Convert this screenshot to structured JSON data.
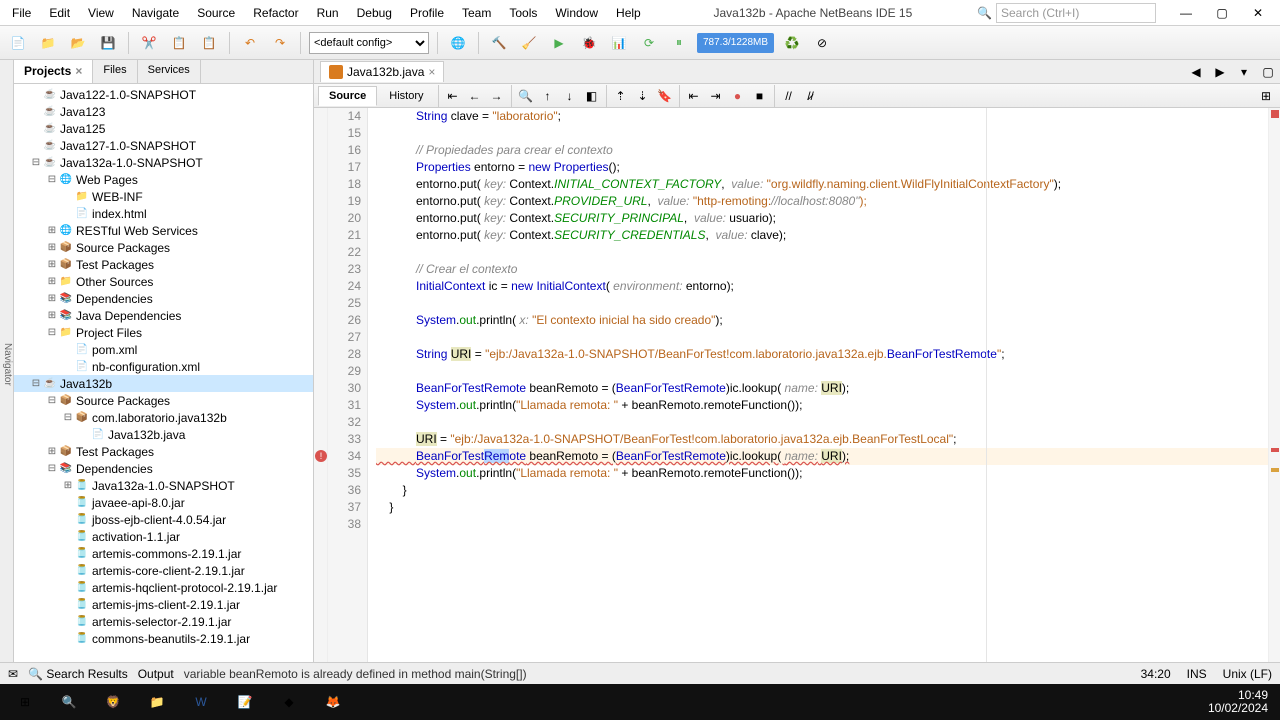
{
  "window": {
    "title": "Java132b - Apache NetBeans IDE 15",
    "search_placeholder": "Search (Ctrl+I)"
  },
  "menus": [
    "File",
    "Edit",
    "View",
    "Navigate",
    "Source",
    "Refactor",
    "Run",
    "Debug",
    "Profile",
    "Team",
    "Tools",
    "Window",
    "Help"
  ],
  "config_select": "<default config>",
  "memory": "787.3/1228MB",
  "left_tabs": {
    "projects": "Projects",
    "files": "Files",
    "services": "Services"
  },
  "tree": [
    {
      "d": 1,
      "exp": "",
      "icon": "☕",
      "label": "Java122-1.0-SNAPSHOT"
    },
    {
      "d": 1,
      "exp": "",
      "icon": "☕",
      "label": "Java123"
    },
    {
      "d": 1,
      "exp": "",
      "icon": "☕",
      "label": "Java125"
    },
    {
      "d": 1,
      "exp": "",
      "icon": "☕",
      "label": "Java127-1.0-SNAPSHOT"
    },
    {
      "d": 1,
      "exp": "−",
      "icon": "☕",
      "label": "Java132a-1.0-SNAPSHOT"
    },
    {
      "d": 2,
      "exp": "−",
      "icon": "🌐",
      "label": "Web Pages"
    },
    {
      "d": 3,
      "exp": "",
      "icon": "📁",
      "label": "WEB-INF"
    },
    {
      "d": 3,
      "exp": "",
      "icon": "📄",
      "label": "index.html"
    },
    {
      "d": 2,
      "exp": "+",
      "icon": "🌐",
      "label": "RESTful Web Services"
    },
    {
      "d": 2,
      "exp": "+",
      "icon": "📦",
      "label": "Source Packages"
    },
    {
      "d": 2,
      "exp": "+",
      "icon": "📦",
      "label": "Test Packages"
    },
    {
      "d": 2,
      "exp": "+",
      "icon": "📁",
      "label": "Other Sources"
    },
    {
      "d": 2,
      "exp": "+",
      "icon": "📚",
      "label": "Dependencies"
    },
    {
      "d": 2,
      "exp": "+",
      "icon": "📚",
      "label": "Java Dependencies"
    },
    {
      "d": 2,
      "exp": "−",
      "icon": "📁",
      "label": "Project Files"
    },
    {
      "d": 3,
      "exp": "",
      "icon": "📄",
      "label": "pom.xml"
    },
    {
      "d": 3,
      "exp": "",
      "icon": "📄",
      "label": "nb-configuration.xml"
    },
    {
      "d": 1,
      "exp": "−",
      "icon": "☕",
      "label": "Java132b",
      "sel": true
    },
    {
      "d": 2,
      "exp": "−",
      "icon": "📦",
      "label": "Source Packages"
    },
    {
      "d": 3,
      "exp": "−",
      "icon": "📦",
      "label": "com.laboratorio.java132b"
    },
    {
      "d": 4,
      "exp": "",
      "icon": "📄",
      "label": "Java132b.java"
    },
    {
      "d": 2,
      "exp": "+",
      "icon": "📦",
      "label": "Test Packages"
    },
    {
      "d": 2,
      "exp": "−",
      "icon": "📚",
      "label": "Dependencies"
    },
    {
      "d": 3,
      "exp": "+",
      "icon": "🫙",
      "label": "Java132a-1.0-SNAPSHOT"
    },
    {
      "d": 3,
      "exp": "",
      "icon": "🫙",
      "label": "javaee-api-8.0.jar"
    },
    {
      "d": 3,
      "exp": "",
      "icon": "🫙",
      "label": "jboss-ejb-client-4.0.54.jar"
    },
    {
      "d": 3,
      "exp": "",
      "icon": "🫙",
      "label": "activation-1.1.jar"
    },
    {
      "d": 3,
      "exp": "",
      "icon": "🫙",
      "label": "artemis-commons-2.19.1.jar"
    },
    {
      "d": 3,
      "exp": "",
      "icon": "🫙",
      "label": "artemis-core-client-2.19.1.jar"
    },
    {
      "d": 3,
      "exp": "",
      "icon": "🫙",
      "label": "artemis-hqclient-protocol-2.19.1.jar"
    },
    {
      "d": 3,
      "exp": "",
      "icon": "🫙",
      "label": "artemis-jms-client-2.19.1.jar"
    },
    {
      "d": 3,
      "exp": "",
      "icon": "🫙",
      "label": "artemis-selector-2.19.1.jar"
    },
    {
      "d": 3,
      "exp": "",
      "icon": "🫙",
      "label": "commons-beanutils-2.19.1.jar"
    }
  ],
  "editor_tab": "Java132b.java",
  "ed_subtabs": {
    "source": "Source",
    "history": "History"
  },
  "line_start": 14,
  "line_end": 38,
  "error_line": 34,
  "status": {
    "search_results": "Search Results",
    "output": "Output",
    "message": "variable beanRemoto is already defined in method main(String[])",
    "pos": "34:20",
    "ins": "INS",
    "encoding": "Unix (LF)"
  },
  "clock": {
    "time": "10:49",
    "date": "10/02/2024"
  },
  "code_lines": [
    "            String clave = \"laboratorio\";",
    "",
    "            // Propiedades para crear el contexto",
    "            Properties entorno = new Properties();",
    "            entorno.put( key: Context.INITIAL_CONTEXT_FACTORY,  value: \"org.wildfly.naming.client.WildFlyInitialContextFactory\");",
    "            entorno.put( key: Context.PROVIDER_URL,  value: \"http-remoting://localhost:8080\");",
    "            entorno.put( key: Context.SECURITY_PRINCIPAL,  value: usuario);",
    "            entorno.put( key: Context.SECURITY_CREDENTIALS,  value: clave);",
    "",
    "            // Crear el contexto",
    "            InitialContext ic = new InitialContext( environment: entorno);",
    "",
    "            System.out.println( x: \"El contexto inicial ha sido creado\");",
    "",
    "            String URI = \"ejb:/Java132a-1.0-SNAPSHOT/BeanForTest!com.laboratorio.java132a.ejb.BeanForTestRemote\";",
    "",
    "            BeanForTestRemote beanRemoto = (BeanForTestRemote)ic.lookup( name: URI);",
    "            System.out.println(\"Llamada remota: \" + beanRemoto.remoteFunction());",
    "",
    "            URI = \"ejb:/Java132a-1.0-SNAPSHOT/BeanForTest!com.laboratorio.java132a.ejb.BeanForTestLocal\";",
    "            BeanForTestRemote beanRemoto = (BeanForTestRemote)ic.lookup( name: URI);",
    "            System.out.println(\"Llamada remota: \" + beanRemoto.remoteFunction());",
    "        }",
    "    }",
    ""
  ]
}
